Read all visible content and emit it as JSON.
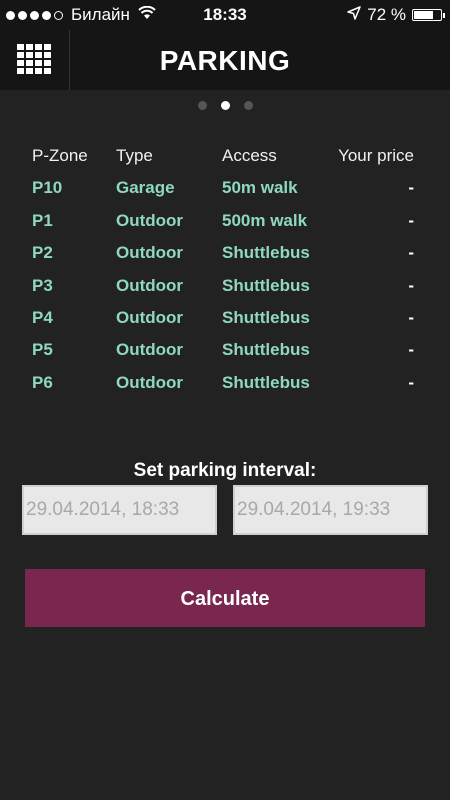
{
  "status_bar": {
    "carrier": "Билайн",
    "time": "18:33",
    "battery_text": "72 %",
    "battery_level": 0.72,
    "signal_bars_filled": 4,
    "signal_bars_total": 5
  },
  "header": {
    "title": "PARKING",
    "menu_icon": "grid-menu-icon"
  },
  "pager": {
    "count": 3,
    "active_index": 1
  },
  "table": {
    "columns": [
      "P-Zone",
      "Type",
      "Access",
      "Your price"
    ],
    "rows": [
      {
        "zone": "P10",
        "type": "Garage",
        "access": "50m walk",
        "price": "-"
      },
      {
        "zone": "P1",
        "type": "Outdoor",
        "access": "500m walk",
        "price": "-"
      },
      {
        "zone": "P2",
        "type": "Outdoor",
        "access": "Shuttlebus",
        "price": "-"
      },
      {
        "zone": "P3",
        "type": "Outdoor",
        "access": "Shuttlebus",
        "price": "-"
      },
      {
        "zone": "P4",
        "type": "Outdoor",
        "access": "Shuttlebus",
        "price": "-"
      },
      {
        "zone": "P5",
        "type": "Outdoor",
        "access": "Shuttlebus",
        "price": "-"
      },
      {
        "zone": "P6",
        "type": "Outdoor",
        "access": "Shuttlebus",
        "price": "-"
      }
    ]
  },
  "interval": {
    "label": "Set parking interval:",
    "from_value": "29.04.2014, 18:33",
    "to_value": "29.04.2014, 19:33"
  },
  "calculate_button": {
    "label": "Calculate"
  },
  "colors": {
    "background": "#222222",
    "header_bg": "#151515",
    "accent_text": "#8fd8c0",
    "button": "#7a2750"
  }
}
